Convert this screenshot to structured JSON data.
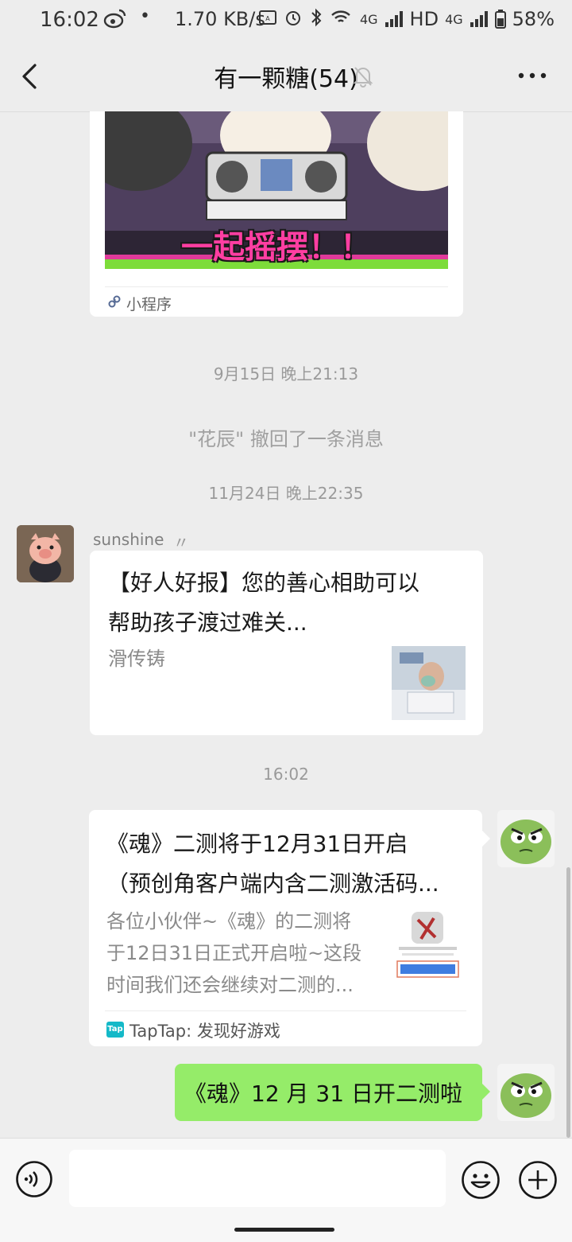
{
  "status_bar": {
    "time": "16:02",
    "dot": "•",
    "net_speed": "1.70 KB/s",
    "network_1": "4G",
    "hd": "HD",
    "network_2": "4G",
    "battery": "58%"
  },
  "header": {
    "title": "有一颗糖(54)"
  },
  "messages": {
    "mini_program": {
      "banner_text": "一起摇摆！！",
      "label": "小程序"
    },
    "ts1": "9月15日 晚上21:13",
    "recall_notice": "\"花辰\" 撤回了一条消息",
    "ts2": "11月24日 晚上22:35",
    "sunshine": {
      "sender": "sunshine",
      "tag": "〃",
      "title_line1": "【好人好报】您的善心相助可以",
      "title_line2": "帮助孩子渡过难关...",
      "subtitle": "滑传铸"
    },
    "ts3": "16:02",
    "taptap": {
      "title_line1": "《魂》二测将于12月31日开启",
      "title_line2": "（预创角客户端内含二测激活码...",
      "desc_line1": "各位小伙伴~《魂》的二测将",
      "desc_line2": "于12日31日正式开启啦~这段",
      "desc_line3": "时间我们还会继续对二测的...",
      "footer": "TapTap: 发现好游戏",
      "footer_logo": "Tap"
    },
    "my_text": "《魂》12 月 31 日开二测啦"
  },
  "colors": {
    "background": "#ededed",
    "my_bubble": "#95ec69",
    "taptap_brand": "#14b9c8"
  }
}
